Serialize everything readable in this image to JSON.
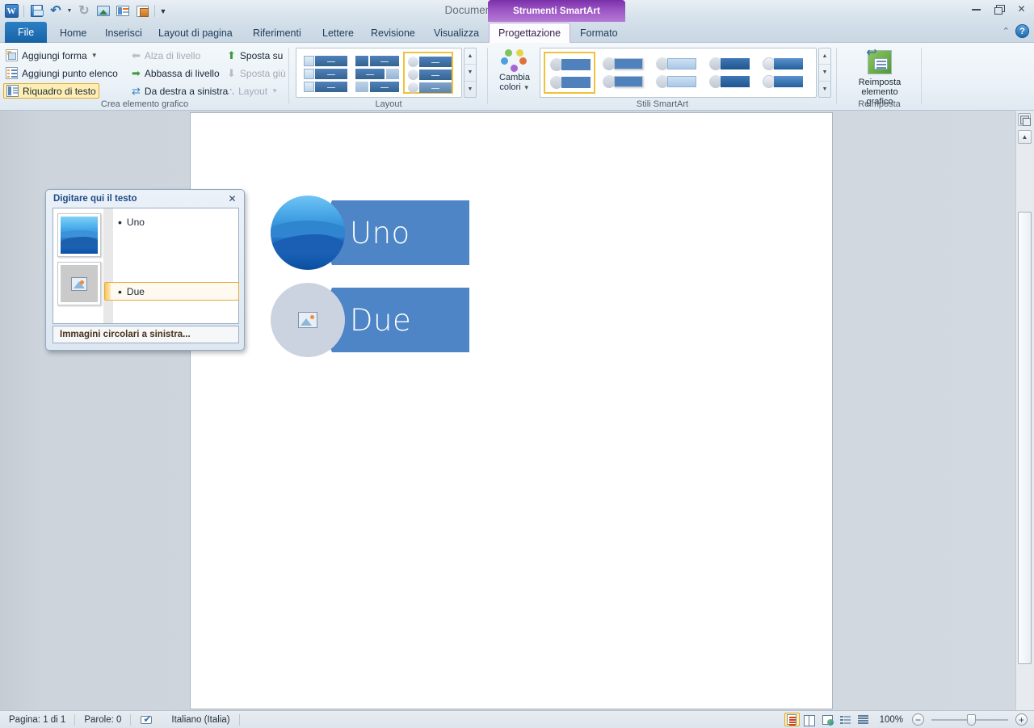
{
  "window": {
    "title": "Documento2  -  Microsoft Word",
    "minimize_label": "Riduci a icona",
    "restore_label": "Ripristino",
    "close_label": "Chiudi"
  },
  "quick_access": {
    "items": [
      {
        "name": "word-logo",
        "label": "W"
      },
      {
        "name": "save",
        "label": "Salva"
      },
      {
        "name": "undo",
        "label": "Annulla"
      },
      {
        "name": "redo",
        "label": "Ripeti"
      },
      {
        "name": "picture",
        "label": "Immagine"
      },
      {
        "name": "window",
        "label": "Finestra"
      },
      {
        "name": "document",
        "label": "Documento"
      },
      {
        "name": "customize",
        "label": "Personalizza barra di accesso rapido"
      }
    ]
  },
  "contextual": {
    "banner": "Strumenti SmartArt"
  },
  "tabs": [
    {
      "id": "file",
      "label": "File"
    },
    {
      "id": "home",
      "label": "Home"
    },
    {
      "id": "insert",
      "label": "Inserisci"
    },
    {
      "id": "pagelayout",
      "label": "Layout di pagina"
    },
    {
      "id": "references",
      "label": "Riferimenti"
    },
    {
      "id": "mailings",
      "label": "Lettere"
    },
    {
      "id": "review",
      "label": "Revisione"
    },
    {
      "id": "view",
      "label": "Visualizza"
    },
    {
      "id": "design",
      "label": "Progettazione"
    },
    {
      "id": "format",
      "label": "Formato"
    }
  ],
  "help": {
    "collapse_label": "Riduci a icona barra multifunzione",
    "help_label": "?"
  },
  "ribbon": {
    "groups": [
      {
        "id": "create-graphic",
        "label": "Crea elemento grafico",
        "commands": [
          {
            "id": "add-shape",
            "label": "Aggiungi forma",
            "enabled": true,
            "has_dropdown": true
          },
          {
            "id": "add-bullet",
            "label": "Aggiungi punto elenco",
            "enabled": true,
            "has_dropdown": false
          },
          {
            "id": "text-pane",
            "label": "Riquadro di testo",
            "enabled": true,
            "selected": true,
            "has_dropdown": false
          },
          {
            "id": "promote",
            "label": "Alza di livello",
            "enabled": false,
            "has_dropdown": false
          },
          {
            "id": "demote",
            "label": "Abbassa di livello",
            "enabled": true,
            "has_dropdown": false
          },
          {
            "id": "rtl",
            "label": "Da destra a sinistra",
            "enabled": true,
            "has_dropdown": false
          },
          {
            "id": "move-up",
            "label": "Sposta su",
            "enabled": true,
            "has_dropdown": false
          },
          {
            "id": "move-down",
            "label": "Sposta giù",
            "enabled": false,
            "has_dropdown": false
          },
          {
            "id": "layout",
            "label": "Layout",
            "enabled": false,
            "has_dropdown": true
          }
        ]
      },
      {
        "id": "layouts",
        "label": "Layout",
        "gallery_items": [
          {
            "id": "layout-1",
            "selected": false
          },
          {
            "id": "layout-2",
            "selected": false
          },
          {
            "id": "layout-3",
            "selected": true
          }
        ],
        "scroll": {
          "up": "▲",
          "down": "▼",
          "more": "▼"
        }
      },
      {
        "id": "smartart-styles",
        "label": "Stili SmartArt",
        "change_colors_label": "Cambia\ncolori",
        "change_colors_line1": "Cambia",
        "change_colors_line2": "colori",
        "gallery_items": [
          {
            "id": "style-1",
            "selected": true
          },
          {
            "id": "style-2",
            "selected": false
          },
          {
            "id": "style-3",
            "selected": false
          },
          {
            "id": "style-4",
            "selected": false
          },
          {
            "id": "style-5",
            "selected": false
          }
        ],
        "scroll": {
          "up": "▲",
          "down": "▼",
          "more": "▼"
        }
      },
      {
        "id": "reset",
        "label": "Reimposta",
        "button_line1": "Reimposta",
        "button_line2": "elemento grafico"
      }
    ]
  },
  "text_pane": {
    "title": "Digitare qui il testo",
    "close_label": "✕",
    "entries": [
      {
        "id": "entry-1",
        "text": "Uno",
        "bullet": "•",
        "selected": false,
        "thumb": "filled-picture"
      },
      {
        "id": "entry-2",
        "text": "Due",
        "bullet": "•",
        "selected": true,
        "thumb": "empty-placeholder"
      }
    ],
    "footer": "Immagini circolari a sinistra..."
  },
  "smartart": {
    "nodes": [
      {
        "id": "node-1",
        "label": "Uno",
        "picture": "filled",
        "shape_color": "#4d85c6",
        "circle_color": "#1f6fc4"
      },
      {
        "id": "node-2",
        "label": "Due",
        "picture": "empty",
        "shape_color": "#4d85c6",
        "circle_color": "#ccd3e0"
      }
    ]
  },
  "status_bar": {
    "page": "Pagina: 1 di 1",
    "words": "Parole: 0",
    "language": "Italiano (Italia)",
    "spell_icon": "spell-check-icon",
    "views": [
      {
        "id": "print-layout",
        "label": "Layout di stampa",
        "selected": true
      },
      {
        "id": "full-screen-reading",
        "label": "Lettura a schermo intero",
        "selected": false
      },
      {
        "id": "web-layout",
        "label": "Layout Web",
        "selected": false
      },
      {
        "id": "outline",
        "label": "Struttura",
        "selected": false
      },
      {
        "id": "draft",
        "label": "Bozza",
        "selected": false
      }
    ],
    "zoom_level": "100%",
    "zoom_out": "−",
    "zoom_in": "+"
  },
  "colors": {
    "accent_blue": "#4d85c6",
    "contextual_purple": "#9c55c4",
    "selection_yellow": "#f0c13b",
    "file_tab_blue": "#1763a6"
  }
}
